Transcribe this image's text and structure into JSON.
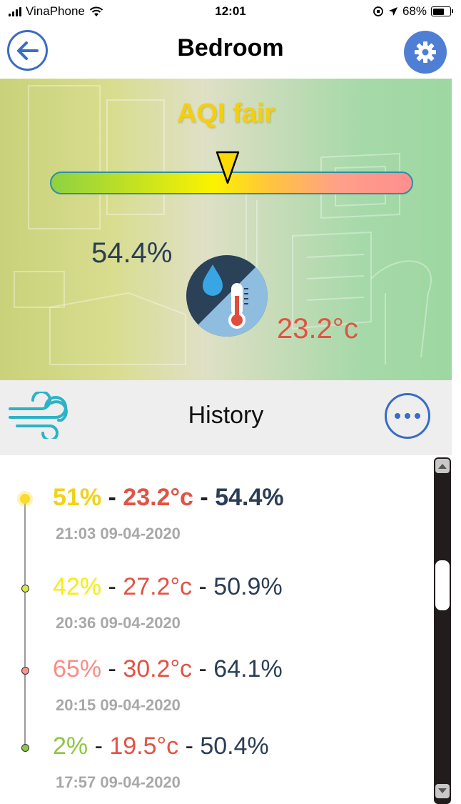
{
  "status_bar": {
    "carrier": "VinaPhone",
    "time": "12:01",
    "battery": "68%",
    "battery_level": 0.68
  },
  "nav": {
    "title": "Bedroom",
    "back_icon": "arrow-left-icon",
    "settings_icon": "gear-icon"
  },
  "hero": {
    "aqi_label": "AQI fair",
    "aqi_marker_position": 0.49,
    "humidity": "54.4%",
    "temperature": "23.2°c",
    "icon": "humidity-temperature-icon"
  },
  "history_header": {
    "title": "History",
    "wind_icon": "wind-icon",
    "more_icon": "more-options-icon"
  },
  "history": {
    "items": [
      {
        "aqi": "51%",
        "temp": "23.2°c",
        "humidity": "54.4%",
        "time": "21:03 09-04-2020",
        "aqi_color": "#f2d216",
        "dot_color": "#fbd92d",
        "bold": true
      },
      {
        "aqi": "42%",
        "temp": "27.2°c",
        "humidity": "50.9%",
        "time": "20:36 09-04-2020",
        "aqi_color": "#f4ee10",
        "dot_color": "#d7e84a",
        "bold": false
      },
      {
        "aqi": "65%",
        "temp": "30.2°c",
        "humidity": "64.1%",
        "time": "20:15 09-04-2020",
        "aqi_color": "#f98d86",
        "dot_color": "#f7968e",
        "bold": false
      },
      {
        "aqi": "2%",
        "temp": "19.5°c",
        "humidity": "50.4%",
        "time": "17:57 09-04-2020",
        "aqi_color": "#8dc740",
        "dot_color": "#8cc84a",
        "bold": false
      }
    ]
  },
  "colors": {
    "accent_blue": "#3a6cc4",
    "temp_red": "#e15344",
    "humidity_navy": "#2b3e55",
    "aqi_yellow": "#f4cf10"
  }
}
